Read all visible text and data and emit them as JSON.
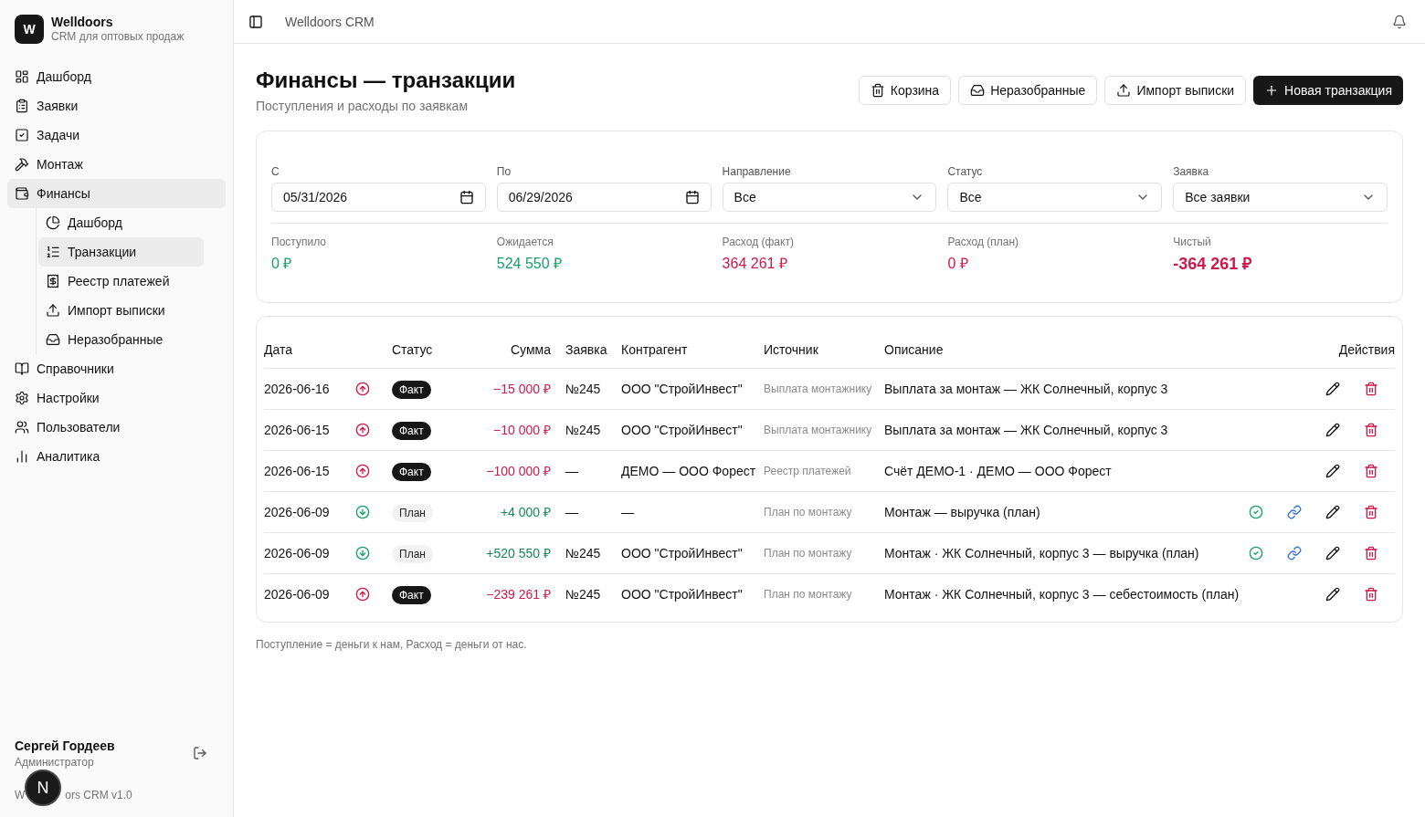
{
  "brand": {
    "logo": "W",
    "name": "Welldoors",
    "tagline": "CRM для оптовых продаж"
  },
  "nav": [
    {
      "label": "Дашборд",
      "selected": false
    },
    {
      "label": "Заявки",
      "selected": false
    },
    {
      "label": "Задачи",
      "selected": false
    },
    {
      "label": "Монтаж",
      "selected": false
    },
    {
      "label": "Финансы",
      "selected": true,
      "children": [
        {
          "label": "Дашборд",
          "selected": false
        },
        {
          "label": "Транзакции",
          "selected": true
        },
        {
          "label": "Реестр платежей",
          "selected": false
        },
        {
          "label": "Импорт выписки",
          "selected": false
        },
        {
          "label": "Неразобранные",
          "selected": false
        }
      ]
    },
    {
      "label": "Справочники",
      "selected": false
    },
    {
      "label": "Настройки",
      "selected": false
    },
    {
      "label": "Пользователи",
      "selected": false
    },
    {
      "label": "Аналитика",
      "selected": false
    }
  ],
  "user": {
    "name": "Сергей Гордеев",
    "role": "Администратор"
  },
  "version_parts": [
    "W",
    "ors CRM v1.0"
  ],
  "dev_badge": "N",
  "topbar": {
    "title": "Welldoors CRM"
  },
  "page": {
    "title": "Финансы — транзакции",
    "subtitle": "Поступления и расходы по заявкам"
  },
  "actions": [
    {
      "label": "Корзина",
      "kind": "outline"
    },
    {
      "label": "Неразобранные",
      "kind": "outline"
    },
    {
      "label": "Импорт выписки",
      "kind": "outline"
    },
    {
      "label": "Новая транзакция",
      "kind": "primary"
    }
  ],
  "filters": [
    {
      "label": "С",
      "value": "05/31/2026",
      "kind": "date"
    },
    {
      "label": "По",
      "value": "06/29/2026",
      "kind": "date"
    },
    {
      "label": "Направление",
      "value": "Все",
      "kind": "select"
    },
    {
      "label": "Статус",
      "value": "Все",
      "kind": "select"
    },
    {
      "label": "Заявка",
      "value": "Все заявки",
      "kind": "select"
    }
  ],
  "summary": [
    {
      "label": "Поступило",
      "value": "0 ₽",
      "color": "#16a06a",
      "kind": "normal"
    },
    {
      "label": "Ожидается",
      "value": "524 550 ₽",
      "color": "#16a06a",
      "kind": "normal"
    },
    {
      "label": "Расход (факт)",
      "value": "364 261 ₽",
      "color": "#d0184a",
      "kind": "normal"
    },
    {
      "label": "Расход (план)",
      "value": "0 ₽",
      "color": "#d0184a",
      "kind": "normal"
    },
    {
      "label": "Чистый",
      "value": "-364 261 ₽",
      "color": "#d0184a",
      "kind": "total"
    }
  ],
  "table": {
    "columns": [
      "Дата",
      "Статус",
      "Сумма",
      "Заявка",
      "Контрагент",
      "Источник",
      "Описание",
      "Действия"
    ],
    "rows": [
      {
        "date": "2026-06-16",
        "kind": "expense",
        "status": "Факт",
        "confirmed": true,
        "amount": "−15 000 ₽",
        "order": "№245",
        "counterparty": "ООО \"СтройИнвест\"",
        "source": "Выплата монтажнику",
        "description": "Выплата за монтаж — ЖК Солнечный, корпус 3"
      },
      {
        "date": "2026-06-15",
        "kind": "expense",
        "status": "Факт",
        "confirmed": true,
        "amount": "−10 000 ₽",
        "order": "№245",
        "counterparty": "ООО \"СтройИнвест\"",
        "source": "Выплата монтажнику",
        "description": "Выплата за монтаж — ЖК Солнечный, корпус 3"
      },
      {
        "date": "2026-06-15",
        "kind": "expense",
        "status": "Факт",
        "confirmed": true,
        "amount": "−100 000 ₽",
        "order": "—",
        "counterparty": "ДЕМО — ООО Форест",
        "source": "Реестр платежей",
        "description": "Счёт ДЕМО-1 · ДЕМО — ООО Форест"
      },
      {
        "date": "2026-06-09",
        "kind": "income",
        "status": "План",
        "confirmed": false,
        "amount": "+4 000 ₽",
        "order": "—",
        "counterparty": "—",
        "source": "План по монтажу",
        "description": "Монтаж — выручка (план)"
      },
      {
        "date": "2026-06-09",
        "kind": "income",
        "status": "План",
        "confirmed": false,
        "amount": "+520 550 ₽",
        "order": "№245",
        "counterparty": "ООО \"СтройИнвест\"",
        "source": "План по монтажу",
        "description": "Монтаж · ЖК Солнечный, корпус 3 — выручка (план)"
      },
      {
        "date": "2026-06-09",
        "kind": "expense",
        "status": "Факт",
        "confirmed": true,
        "amount": "−239 261 ₽",
        "order": "№245",
        "counterparty": "ООО \"СтройИнвест\"",
        "source": "План по монтажу",
        "description": "Монтаж · ЖК Солнечный, корпус 3 — себестоимость (план)"
      }
    ]
  },
  "footnote": "Поступление = деньги к нам, Расход = деньги от нас."
}
